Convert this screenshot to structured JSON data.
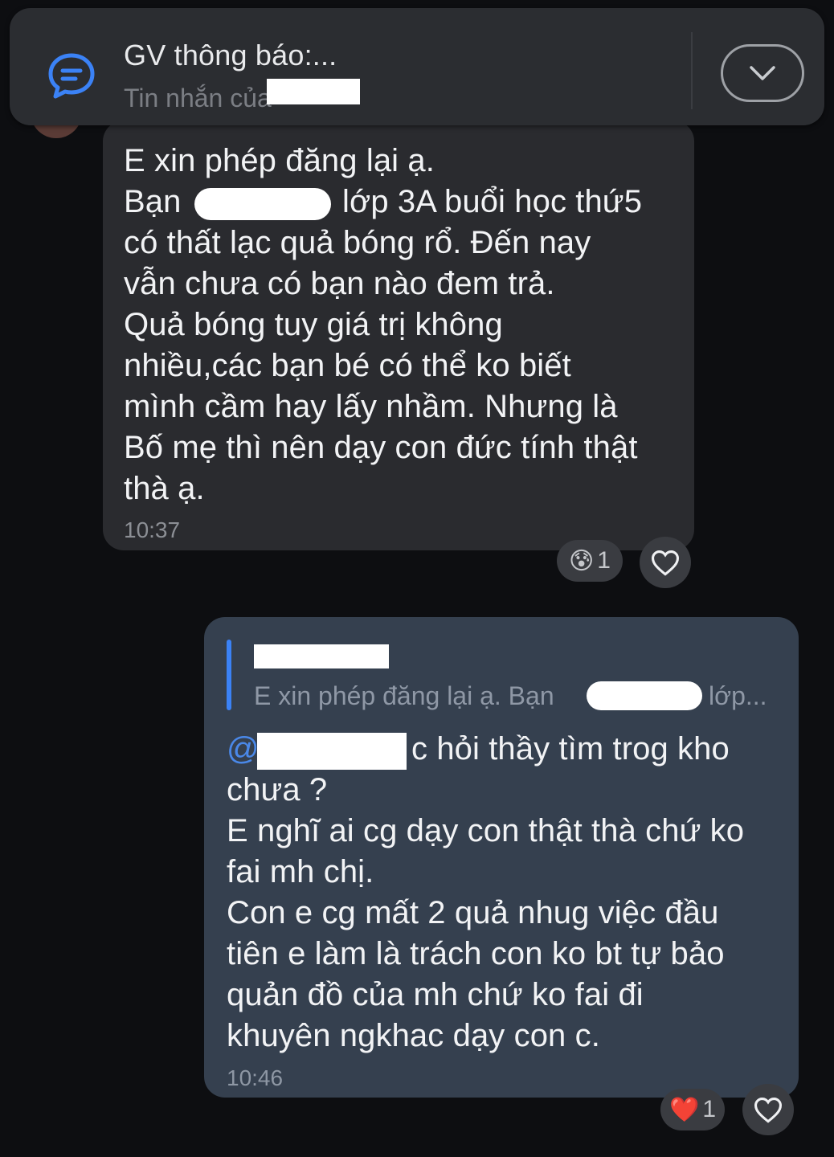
{
  "pinned": {
    "title": "GV thông báo:...",
    "subtitle": "Tin nhắn của",
    "icon": "chat-bubble-icon",
    "toggle_icon": "chevron-down-icon"
  },
  "incoming": {
    "lines": [
      "E xin phép đăng lại ạ.",
      "Bạn",
      "lớp 3A buổi học thứ5",
      "có thất lạc quả bóng rổ. Đến nay",
      "vẫn chưa có bạn nào đem trả.",
      "Quả bóng tuy giá trị không",
      "nhiều,các bạn bé có thể ko biết",
      "mình cầm hay lấy nhầm. Nhưng là",
      "Bố mẹ thì nên dạy con đức tính thật",
      "thà ạ."
    ],
    "time": "10:37",
    "reaction_emoji": "😰",
    "reaction_count": "1"
  },
  "outgoing": {
    "quote_text_a": "E xin phép đăng lại ạ. Bạn",
    "quote_text_b": "lớp...",
    "mention_at": "@",
    "lines": [
      "c hỏi thầy tìm trog kho",
      "chưa ?",
      "E nghĩ ai cg dạy con thật thà chứ ko",
      "fai mh chị.",
      "Con e cg mất 2 quả nhug việc đầu",
      "tiên e làm là trách con ko bt tự  bảo",
      "quản đồ của mh chứ ko fai đi",
      "khuyên ngkhac dạy con c."
    ],
    "time": "10:46",
    "reaction_emoji": "❤️",
    "reaction_count": "1"
  },
  "colors": {
    "accent": "#3b82f6",
    "incoming_bubble": "#2a2b2f",
    "outgoing_bubble": "#35404f",
    "background": "#0d0e11"
  }
}
